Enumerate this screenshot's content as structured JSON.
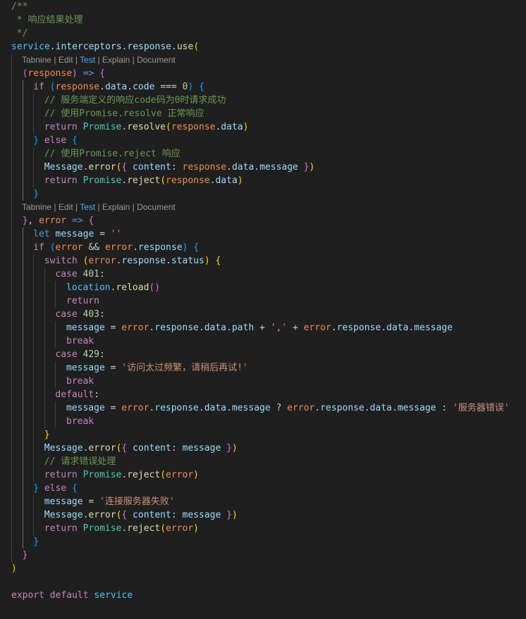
{
  "editor": {
    "language": "javascript",
    "codelens_items": [
      "Tabnine",
      "Edit",
      "Test",
      "Explain",
      "Document"
    ],
    "codelens_separator": " | ",
    "lines": [
      {
        "type": "code",
        "indent": 0,
        "tokens": [
          [
            "c",
            "/**"
          ]
        ]
      },
      {
        "type": "code",
        "indent": 0,
        "tokens": [
          [
            "c",
            " * 响应结果处理"
          ]
        ]
      },
      {
        "type": "code",
        "indent": 0,
        "tokens": [
          [
            "c",
            " */"
          ]
        ]
      },
      {
        "type": "code",
        "indent": 0,
        "tokens": [
          [
            "vb",
            "service"
          ],
          [
            "ps",
            "."
          ],
          [
            "pr",
            "interceptors"
          ],
          [
            "ps",
            "."
          ],
          [
            "pr",
            "response"
          ],
          [
            "ps",
            "."
          ],
          [
            "fn",
            "use"
          ],
          [
            "b1",
            "("
          ]
        ]
      },
      {
        "type": "lens",
        "indent": 1
      },
      {
        "type": "code",
        "indent": 1,
        "tokens": [
          [
            "b2",
            "("
          ],
          [
            "pa",
            "response"
          ],
          [
            "b2",
            ")"
          ],
          [
            "ps",
            " "
          ],
          [
            "st",
            "=>"
          ],
          [
            "ps",
            " "
          ],
          [
            "b2",
            "{"
          ]
        ]
      },
      {
        "type": "code",
        "indent": 2,
        "tokens": [
          [
            "kw",
            "if"
          ],
          [
            "ps",
            " "
          ],
          [
            "b3",
            "("
          ],
          [
            "pa",
            "response"
          ],
          [
            "ps",
            "."
          ],
          [
            "pr",
            "data"
          ],
          [
            "ps",
            "."
          ],
          [
            "pr",
            "code"
          ],
          [
            "ps",
            " === "
          ],
          [
            "nm",
            "0"
          ],
          [
            "b3",
            ")"
          ],
          [
            "ps",
            " "
          ],
          [
            "b3",
            "{"
          ]
        ]
      },
      {
        "type": "code",
        "indent": 3,
        "tokens": [
          [
            "c",
            "// 服务端定义的响应code码为0时请求成功"
          ]
        ]
      },
      {
        "type": "code",
        "indent": 3,
        "tokens": [
          [
            "c",
            "// 使用Promise.resolve 正常响应"
          ]
        ]
      },
      {
        "type": "code",
        "indent": 3,
        "tokens": [
          [
            "kw",
            "return"
          ],
          [
            "ps",
            " "
          ],
          [
            "ty",
            "Promise"
          ],
          [
            "ps",
            "."
          ],
          [
            "fn",
            "resolve"
          ],
          [
            "b1",
            "("
          ],
          [
            "pa",
            "response"
          ],
          [
            "ps",
            "."
          ],
          [
            "pr",
            "data"
          ],
          [
            "b1",
            ")"
          ]
        ]
      },
      {
        "type": "code",
        "indent": 2,
        "tokens": [
          [
            "b3",
            "}"
          ],
          [
            "ps",
            " "
          ],
          [
            "kw",
            "else"
          ],
          [
            "ps",
            " "
          ],
          [
            "b3",
            "{"
          ]
        ]
      },
      {
        "type": "code",
        "indent": 3,
        "tokens": [
          [
            "c",
            "// 使用Promise.reject 响应"
          ]
        ]
      },
      {
        "type": "code",
        "indent": 3,
        "tokens": [
          [
            "pr",
            "Message"
          ],
          [
            "ps",
            "."
          ],
          [
            "fn",
            "error"
          ],
          [
            "b1",
            "("
          ],
          [
            "b2",
            "{"
          ],
          [
            "ps",
            " "
          ],
          [
            "pr",
            "content"
          ],
          [
            "ps",
            ": "
          ],
          [
            "pa",
            "response"
          ],
          [
            "ps",
            "."
          ],
          [
            "pr",
            "data"
          ],
          [
            "ps",
            "."
          ],
          [
            "pr",
            "message"
          ],
          [
            "ps",
            " "
          ],
          [
            "b2",
            "}"
          ],
          [
            "b1",
            ")"
          ]
        ]
      },
      {
        "type": "code",
        "indent": 3,
        "tokens": [
          [
            "kw",
            "return"
          ],
          [
            "ps",
            " "
          ],
          [
            "ty",
            "Promise"
          ],
          [
            "ps",
            "."
          ],
          [
            "fn",
            "reject"
          ],
          [
            "b1",
            "("
          ],
          [
            "pa",
            "response"
          ],
          [
            "ps",
            "."
          ],
          [
            "pr",
            "data"
          ],
          [
            "b1",
            ")"
          ]
        ]
      },
      {
        "type": "code",
        "indent": 2,
        "tokens": [
          [
            "b3",
            "}"
          ]
        ]
      },
      {
        "type": "lens",
        "indent": 1
      },
      {
        "type": "code",
        "indent": 1,
        "tokens": [
          [
            "b2",
            "}"
          ],
          [
            "ps",
            ", "
          ],
          [
            "pa",
            "error"
          ],
          [
            "ps",
            " "
          ],
          [
            "st",
            "=>"
          ],
          [
            "ps",
            " "
          ],
          [
            "b2",
            "{"
          ]
        ]
      },
      {
        "type": "code",
        "indent": 2,
        "tokens": [
          [
            "st",
            "let"
          ],
          [
            "ps",
            " "
          ],
          [
            "d",
            "message"
          ],
          [
            "ps",
            " = "
          ],
          [
            "sr",
            "''"
          ]
        ]
      },
      {
        "type": "code",
        "indent": 2,
        "tokens": [
          [
            "kw",
            "if"
          ],
          [
            "ps",
            " "
          ],
          [
            "b3",
            "("
          ],
          [
            "pa",
            "error"
          ],
          [
            "ps",
            " && "
          ],
          [
            "pa",
            "error"
          ],
          [
            "ps",
            "."
          ],
          [
            "pr",
            "response"
          ],
          [
            "b3",
            ")"
          ],
          [
            "ps",
            " "
          ],
          [
            "b3",
            "{"
          ]
        ]
      },
      {
        "type": "code",
        "indent": 3,
        "tokens": [
          [
            "kw",
            "switch"
          ],
          [
            "ps",
            " "
          ],
          [
            "b1",
            "("
          ],
          [
            "pa",
            "error"
          ],
          [
            "ps",
            "."
          ],
          [
            "pr",
            "response"
          ],
          [
            "ps",
            "."
          ],
          [
            "pr",
            "status"
          ],
          [
            "b1",
            ")"
          ],
          [
            "ps",
            " "
          ],
          [
            "b1",
            "{"
          ]
        ]
      },
      {
        "type": "code",
        "indent": 4,
        "tokens": [
          [
            "kw",
            "case"
          ],
          [
            "ps",
            " "
          ],
          [
            "nm",
            "401"
          ],
          [
            "ps",
            ":"
          ]
        ]
      },
      {
        "type": "code",
        "indent": 5,
        "tokens": [
          [
            "vb",
            "location"
          ],
          [
            "ps",
            "."
          ],
          [
            "fn",
            "reload"
          ],
          [
            "b2",
            "()"
          ]
        ]
      },
      {
        "type": "code",
        "indent": 5,
        "tokens": [
          [
            "kw",
            "return"
          ]
        ]
      },
      {
        "type": "code",
        "indent": 4,
        "tokens": [
          [
            "kw",
            "case"
          ],
          [
            "ps",
            " "
          ],
          [
            "nm",
            "403"
          ],
          [
            "ps",
            ":"
          ]
        ]
      },
      {
        "type": "code",
        "indent": 5,
        "tokens": [
          [
            "d",
            "message"
          ],
          [
            "ps",
            " = "
          ],
          [
            "pa",
            "error"
          ],
          [
            "ps",
            "."
          ],
          [
            "pr",
            "response"
          ],
          [
            "ps",
            "."
          ],
          [
            "pr",
            "data"
          ],
          [
            "ps",
            "."
          ],
          [
            "pr",
            "path"
          ],
          [
            "ps",
            " + "
          ],
          [
            "sr",
            "','"
          ],
          [
            "ps",
            " + "
          ],
          [
            "pa",
            "error"
          ],
          [
            "ps",
            "."
          ],
          [
            "pr",
            "response"
          ],
          [
            "ps",
            "."
          ],
          [
            "pr",
            "data"
          ],
          [
            "ps",
            "."
          ],
          [
            "pr",
            "message"
          ]
        ]
      },
      {
        "type": "code",
        "indent": 5,
        "tokens": [
          [
            "kw",
            "break"
          ]
        ]
      },
      {
        "type": "code",
        "indent": 4,
        "tokens": [
          [
            "kw",
            "case"
          ],
          [
            "ps",
            " "
          ],
          [
            "nm",
            "429"
          ],
          [
            "ps",
            ":"
          ]
        ]
      },
      {
        "type": "code",
        "indent": 5,
        "tokens": [
          [
            "d",
            "message"
          ],
          [
            "ps",
            " = "
          ],
          [
            "sr",
            "'访问太过频繁，请稍后再试!'"
          ]
        ]
      },
      {
        "type": "code",
        "indent": 5,
        "tokens": [
          [
            "kw",
            "break"
          ]
        ]
      },
      {
        "type": "code",
        "indent": 4,
        "tokens": [
          [
            "kw",
            "default"
          ],
          [
            "ps",
            ":"
          ]
        ]
      },
      {
        "type": "code",
        "indent": 5,
        "tokens": [
          [
            "d",
            "message"
          ],
          [
            "ps",
            " = "
          ],
          [
            "pa",
            "error"
          ],
          [
            "ps",
            "."
          ],
          [
            "pr",
            "response"
          ],
          [
            "ps",
            "."
          ],
          [
            "pr",
            "data"
          ],
          [
            "ps",
            "."
          ],
          [
            "pr",
            "message"
          ],
          [
            "ps",
            " ? "
          ],
          [
            "pa",
            "error"
          ],
          [
            "ps",
            "."
          ],
          [
            "pr",
            "response"
          ],
          [
            "ps",
            "."
          ],
          [
            "pr",
            "data"
          ],
          [
            "ps",
            "."
          ],
          [
            "pr",
            "message"
          ],
          [
            "ps",
            " : "
          ],
          [
            "sr",
            "'服务器错误'"
          ]
        ]
      },
      {
        "type": "code",
        "indent": 5,
        "tokens": [
          [
            "kw",
            "break"
          ]
        ]
      },
      {
        "type": "code",
        "indent": 3,
        "tokens": [
          [
            "b1",
            "}"
          ]
        ]
      },
      {
        "type": "code",
        "indent": 3,
        "tokens": [
          [
            "pr",
            "Message"
          ],
          [
            "ps",
            "."
          ],
          [
            "fn",
            "error"
          ],
          [
            "b1",
            "("
          ],
          [
            "b2",
            "{"
          ],
          [
            "ps",
            " "
          ],
          [
            "pr",
            "content"
          ],
          [
            "ps",
            ": "
          ],
          [
            "d",
            "message"
          ],
          [
            "ps",
            " "
          ],
          [
            "b2",
            "}"
          ],
          [
            "b1",
            ")"
          ]
        ]
      },
      {
        "type": "code",
        "indent": 3,
        "tokens": [
          [
            "c",
            "// 请求错误处理"
          ]
        ]
      },
      {
        "type": "code",
        "indent": 3,
        "tokens": [
          [
            "kw",
            "return"
          ],
          [
            "ps",
            " "
          ],
          [
            "ty",
            "Promise"
          ],
          [
            "ps",
            "."
          ],
          [
            "fn",
            "reject"
          ],
          [
            "b1",
            "("
          ],
          [
            "pa",
            "error"
          ],
          [
            "b1",
            ")"
          ]
        ]
      },
      {
        "type": "code",
        "indent": 2,
        "tokens": [
          [
            "b3",
            "}"
          ],
          [
            "ps",
            " "
          ],
          [
            "kw",
            "else"
          ],
          [
            "ps",
            " "
          ],
          [
            "b3",
            "{"
          ]
        ]
      },
      {
        "type": "code",
        "indent": 3,
        "tokens": [
          [
            "d",
            "message"
          ],
          [
            "ps",
            " = "
          ],
          [
            "sr",
            "'连接服务器失败'"
          ]
        ]
      },
      {
        "type": "code",
        "indent": 3,
        "tokens": [
          [
            "pr",
            "Message"
          ],
          [
            "ps",
            "."
          ],
          [
            "fn",
            "error"
          ],
          [
            "b1",
            "("
          ],
          [
            "b2",
            "{"
          ],
          [
            "ps",
            " "
          ],
          [
            "pr",
            "content"
          ],
          [
            "ps",
            ": "
          ],
          [
            "d",
            "message"
          ],
          [
            "ps",
            " "
          ],
          [
            "b2",
            "}"
          ],
          [
            "b1",
            ")"
          ]
        ]
      },
      {
        "type": "code",
        "indent": 3,
        "tokens": [
          [
            "kw",
            "return"
          ],
          [
            "ps",
            " "
          ],
          [
            "ty",
            "Promise"
          ],
          [
            "ps",
            "."
          ],
          [
            "fn",
            "reject"
          ],
          [
            "b1",
            "("
          ],
          [
            "pa",
            "error"
          ],
          [
            "b1",
            ")"
          ]
        ]
      },
      {
        "type": "code",
        "indent": 2,
        "tokens": [
          [
            "b3",
            "}"
          ]
        ]
      },
      {
        "type": "code",
        "indent": 1,
        "tokens": [
          [
            "b2",
            "}"
          ]
        ]
      },
      {
        "type": "code",
        "indent": 0,
        "tokens": [
          [
            "b1",
            ")"
          ]
        ]
      },
      {
        "type": "code",
        "indent": 0,
        "tokens": []
      },
      {
        "type": "code",
        "indent": 0,
        "tokens": [
          [
            "kw",
            "export"
          ],
          [
            "ps",
            " "
          ],
          [
            "kw",
            "default"
          ],
          [
            "ps",
            " "
          ],
          [
            "vb",
            "service"
          ]
        ]
      }
    ]
  }
}
